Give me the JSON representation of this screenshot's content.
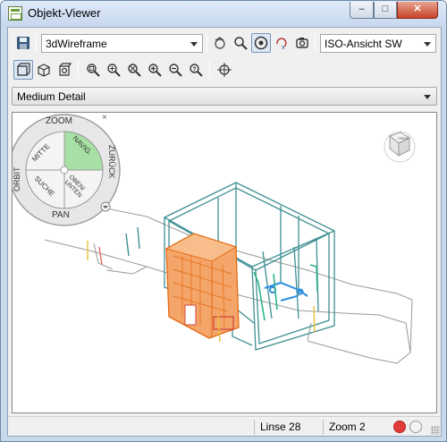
{
  "window": {
    "title": "Objekt-Viewer"
  },
  "toolbar": {
    "save_icon": "save-icon",
    "visual_style": "3dWireframe",
    "view_preset": "ISO-Ansicht SW"
  },
  "detail": {
    "level": "Medium Detail"
  },
  "wheel": {
    "zoom": "ZOOM",
    "orbit": "ORBIT",
    "back": "ZURÜCK",
    "pan": "PAN",
    "center": "MITTE",
    "navig": "NAVIG.",
    "search": "SUCHE",
    "up_down": [
      "OBEN/",
      "UNTEN"
    ]
  },
  "status": {
    "line": "Linse 28",
    "zoom": "Zoom 2"
  },
  "colors": {
    "accent": "#3d6fb6",
    "wire": "#2f7f86",
    "orange": "#f07e1a",
    "status_red": "#e23b3b",
    "status_gray": "#d9d9d9"
  }
}
